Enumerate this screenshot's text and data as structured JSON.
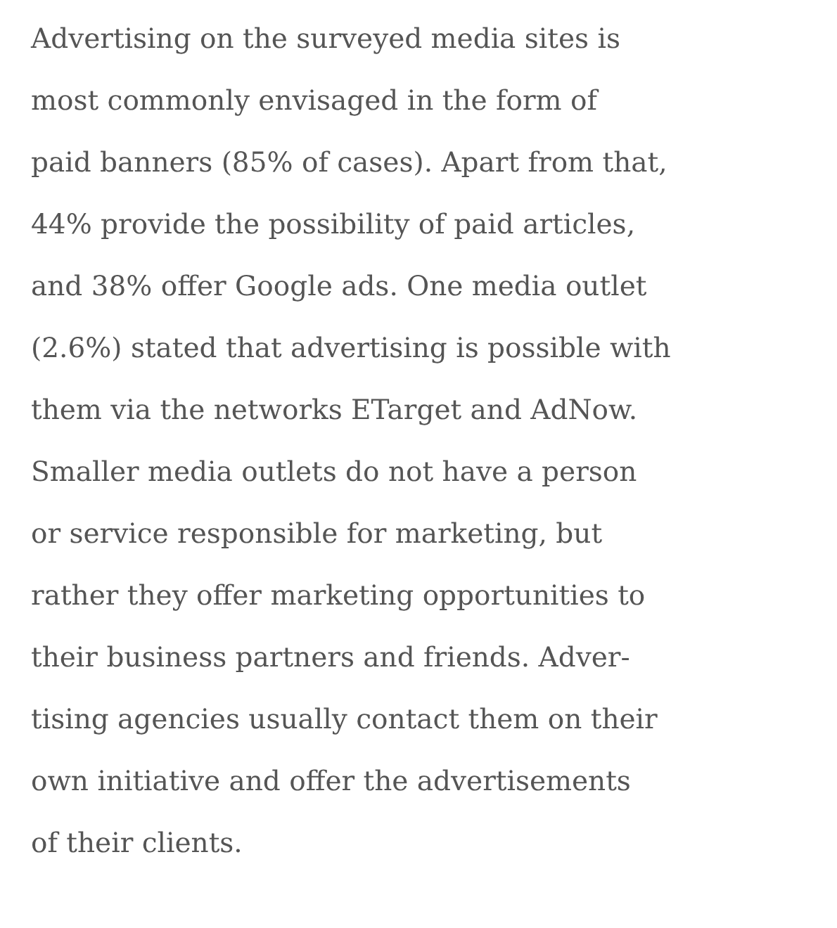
{
  "article": {
    "paragraph": "Advertising on the surveyed media sites is\nmost commonly envisaged in the form of\npaid banners (85% of cases). Apart from that,\n44% provide the possibility of paid articles,\nand 38% offer Google ads. One media outlet\n(2.6%) stated that advertising is possible with\nthem via the networks ETarget and AdNow.\nSmaller media outlets do not have a person\nor service responsible for marketing, but\nrather they offer marketing opportunities to\ntheir business partners and friends. Adver-\ntising agencies usually contact them on their\nown initiative and offer the advertisements\nof their clients."
  }
}
